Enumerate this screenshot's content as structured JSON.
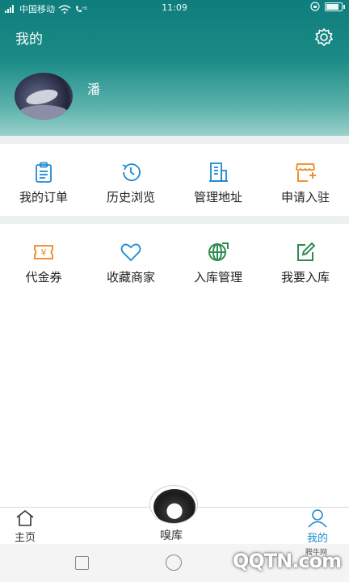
{
  "status_bar": {
    "carrier": "中国移动",
    "time": "11:09",
    "battery_level": 0.85
  },
  "header": {
    "title": "我的",
    "settings_icon": "gear-icon"
  },
  "user": {
    "name": "潘"
  },
  "grid_row_1": [
    {
      "label": "我的订单",
      "icon": "clipboard-icon",
      "color": "#1d8ad0"
    },
    {
      "label": "历史浏览",
      "icon": "history-icon",
      "color": "#1d8ad0"
    },
    {
      "label": "管理地址",
      "icon": "building-icon",
      "color": "#1d8ad0"
    },
    {
      "label": "申请入驻",
      "icon": "storefront-plus-icon",
      "color": "#f0841f"
    }
  ],
  "grid_row_2": [
    {
      "label": "代金券",
      "icon": "coupon-icon",
      "color": "#f0841f"
    },
    {
      "label": "收藏商家",
      "icon": "heart-icon",
      "color": "#1d8ad0"
    },
    {
      "label": "入库管理",
      "icon": "globe-arrow-icon",
      "color": "#2b8a4e"
    },
    {
      "label": "我要入库",
      "icon": "edit-icon",
      "color": "#2b8a4e"
    }
  ],
  "bottom_nav": {
    "home": "主页",
    "center": "嗅库",
    "mine": "我的",
    "active_color": "#1d8ad0"
  },
  "watermark": {
    "logo": "QQTN.com",
    "small": "腾牛网"
  }
}
